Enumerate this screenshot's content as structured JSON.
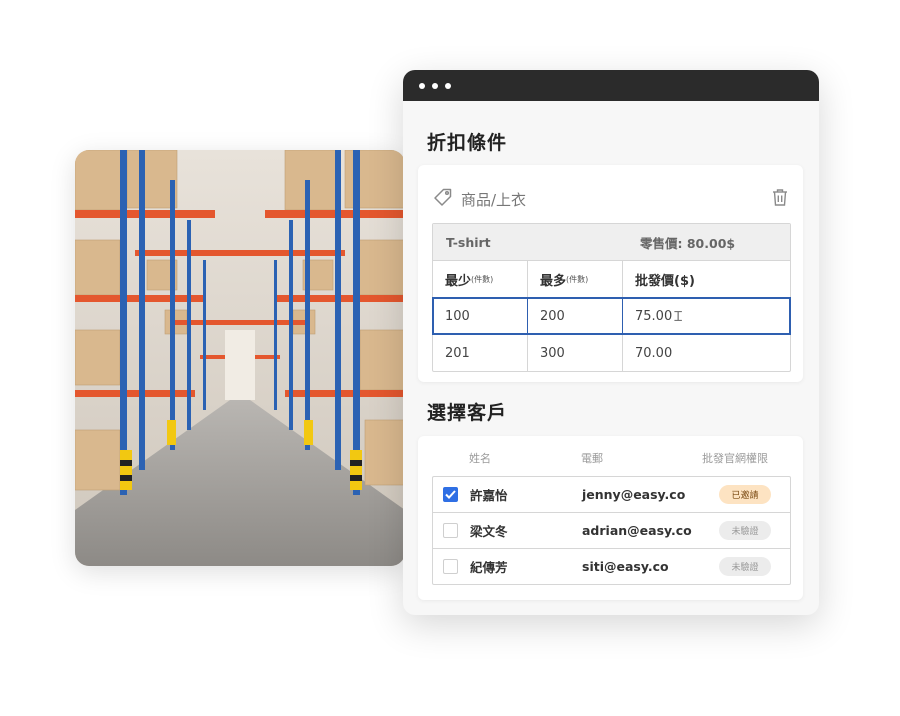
{
  "window": {
    "discount_section": {
      "title": "折扣條件",
      "product_label": "商品/上衣",
      "product_name": "T-shirt",
      "retail_price": "零售價: 80.00$",
      "columns": {
        "min": "最少",
        "min_unit": "(件數)",
        "max": "最多",
        "max_unit": "(件數)",
        "price": "批發價($)"
      },
      "rows": [
        {
          "min": "100",
          "max": "200",
          "price": "75.00"
        },
        {
          "min": "201",
          "max": "300",
          "price": "70.00"
        }
      ]
    },
    "customer_section": {
      "title": "選擇客戶",
      "columns": {
        "name": "姓名",
        "email": "電郵",
        "status": "批發官網權限"
      },
      "rows": [
        {
          "name": "許嘉怡",
          "email": "jenny@easy.co",
          "status": "已邀請",
          "checked": true
        },
        {
          "name": "梁文冬",
          "email": "adrian@easy.co",
          "status": "未驗證",
          "checked": false
        },
        {
          "name": "紀傳芳",
          "email": "siti@easy.co",
          "status": "未驗證",
          "checked": false
        }
      ]
    }
  },
  "colors": {
    "titlebar": "#2b2b2b",
    "accent": "#2f6fe4",
    "active_border": "#2e5fb0",
    "invited_badge": "#fde3c2"
  },
  "icons": [
    "tag-icon",
    "trash-icon",
    "text-cursor-icon",
    "check-icon"
  ]
}
